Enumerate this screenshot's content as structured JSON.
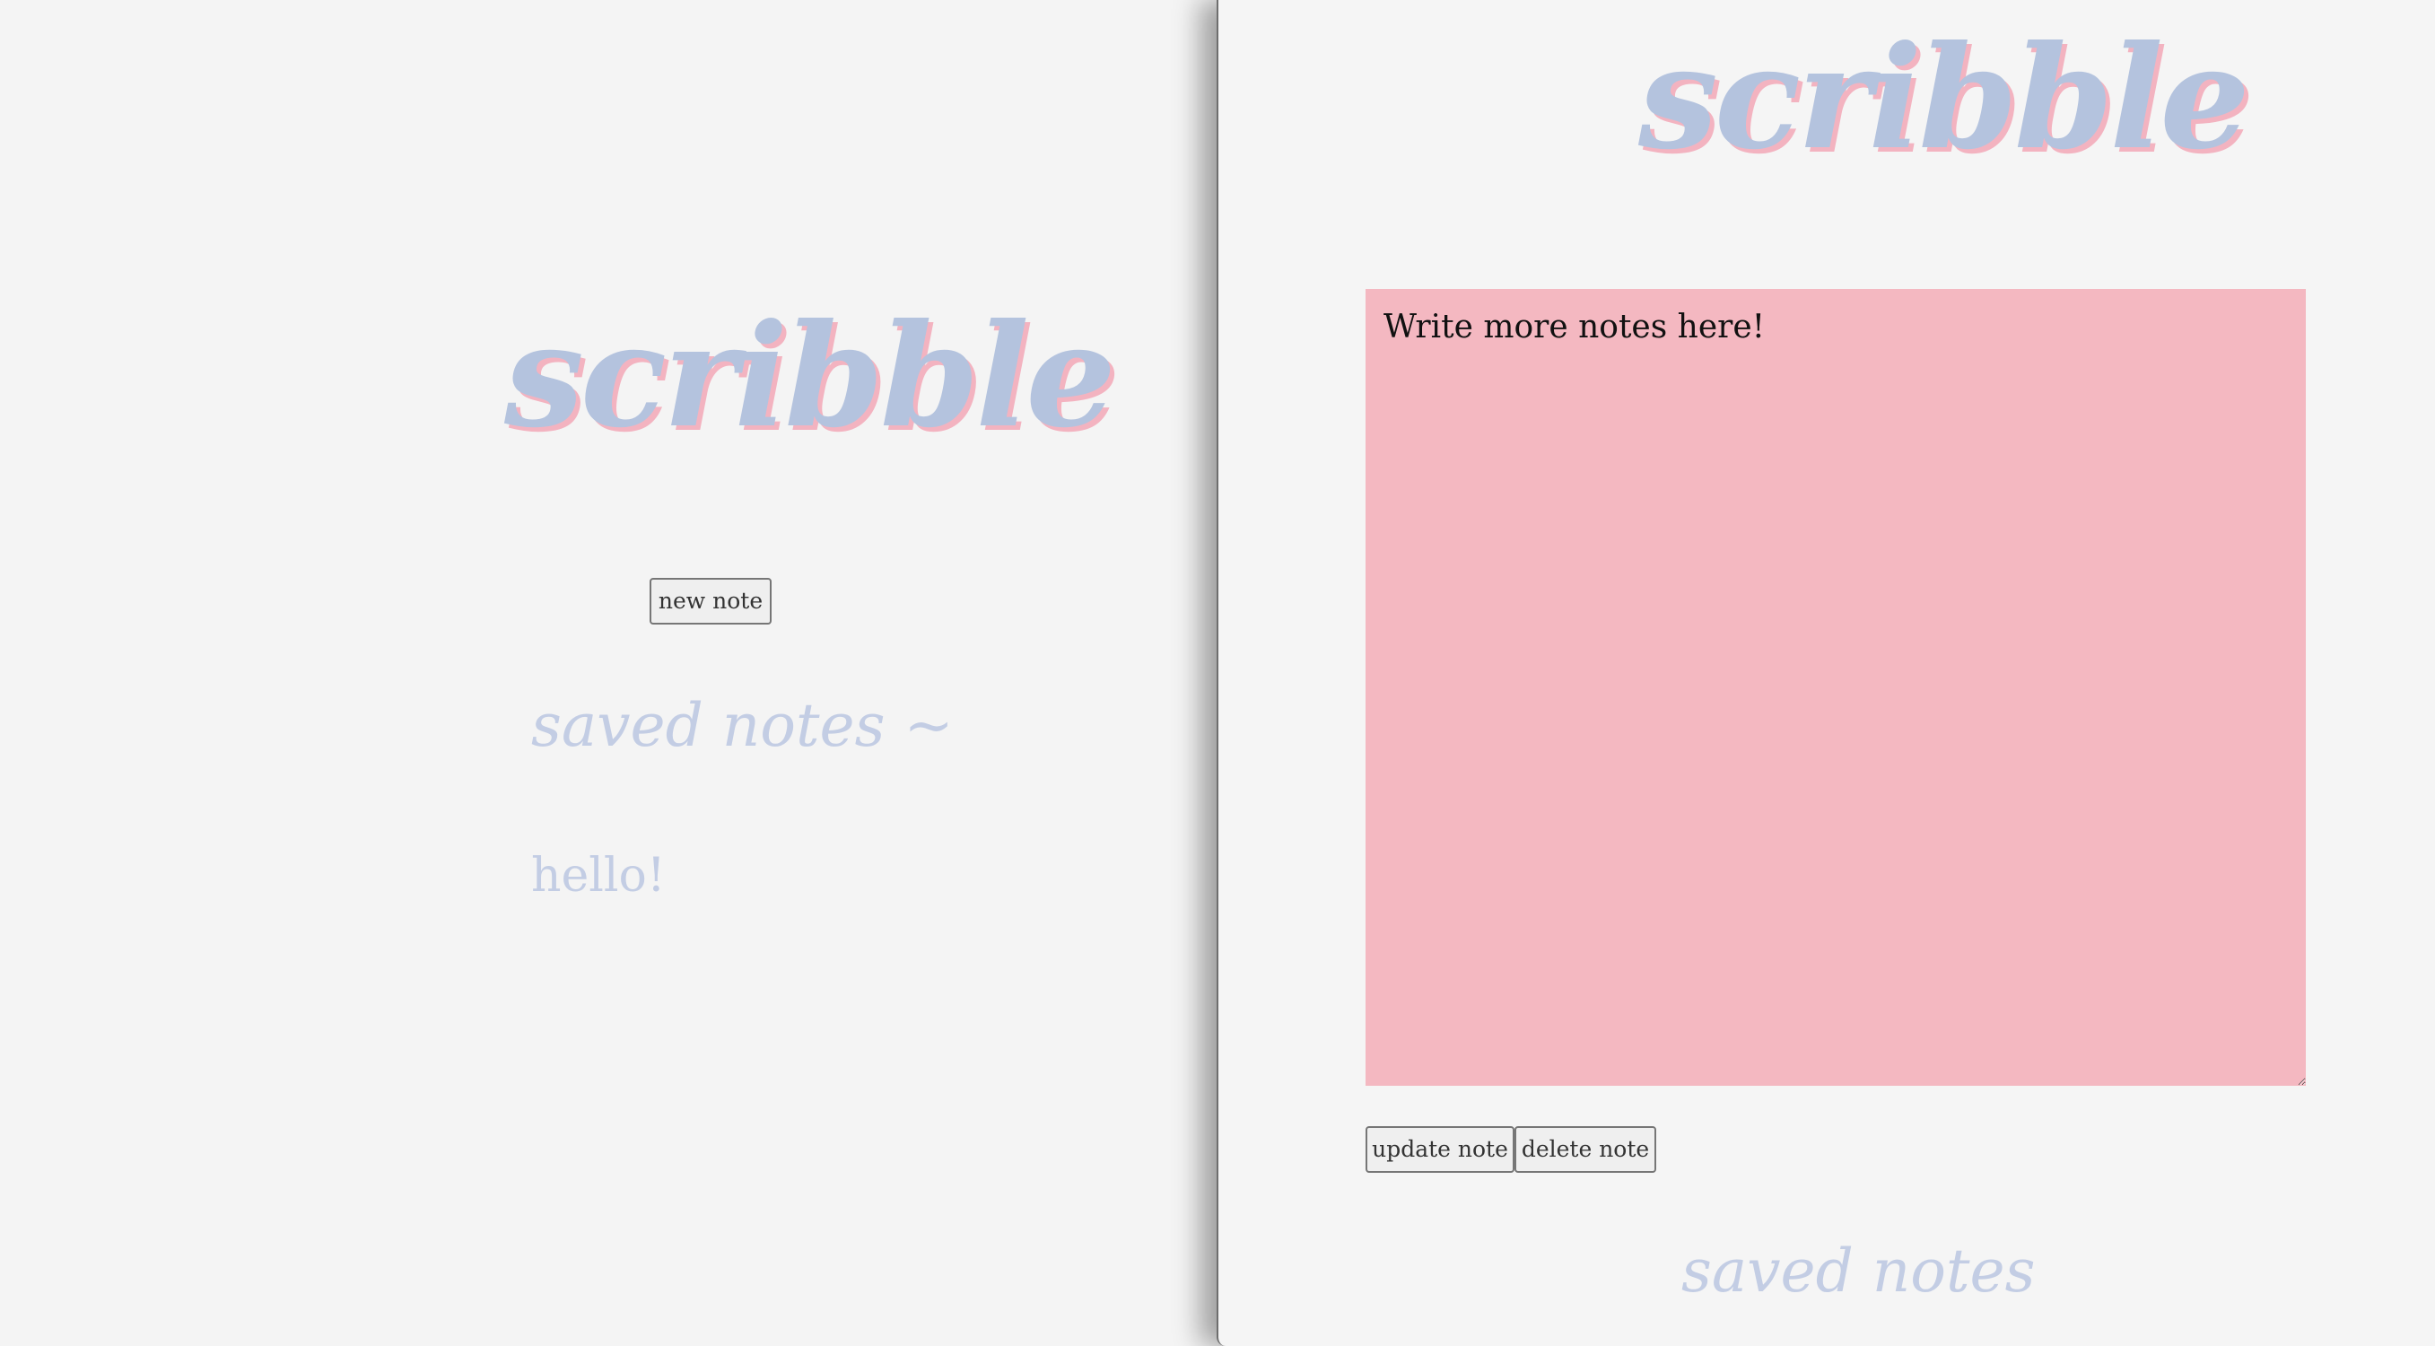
{
  "app": {
    "logo_text": "scribble"
  },
  "left_window": {
    "new_note_label": "new note",
    "saved_heading": "saved notes ~",
    "saved_notes": [
      "hello!"
    ]
  },
  "right_window": {
    "note_text": "Write more notes here!",
    "update_label": "update note",
    "delete_label": "delete note",
    "saved_heading": "saved notes"
  },
  "colors": {
    "logo": "#b4c3de",
    "logo_shadow": "#f3b3c0",
    "note_background": "#f4b8c1",
    "heading_text": "#c3cde4",
    "page_background": "#f5f5f5"
  }
}
